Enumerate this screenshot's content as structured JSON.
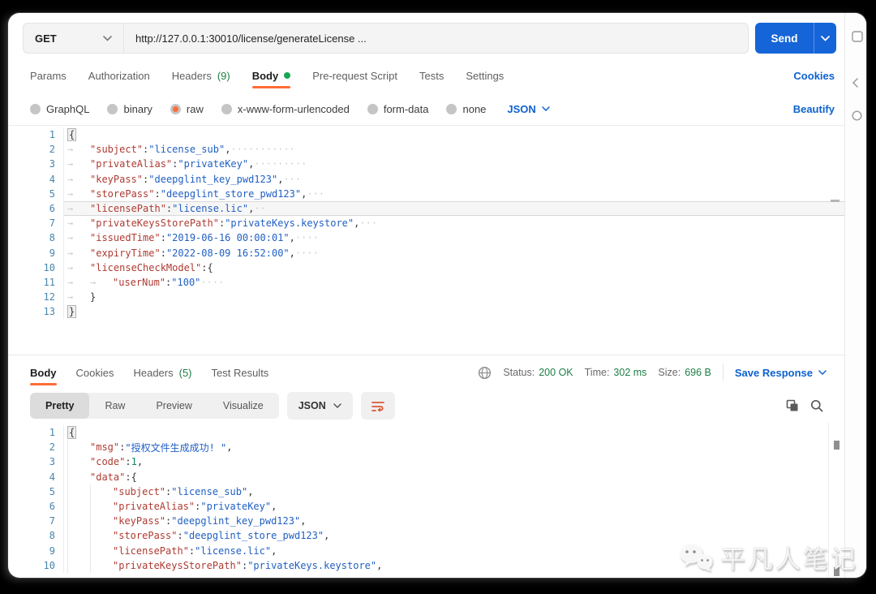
{
  "request_bar": {
    "method": "GET",
    "url": "http://127.0.0.1:30010/license/generateLicense ...",
    "send_label": "Send"
  },
  "request_tabs": {
    "items": [
      {
        "label": "Params"
      },
      {
        "label": "Authorization"
      },
      {
        "label": "Headers",
        "count": "(9)"
      },
      {
        "label": "Body",
        "active": true,
        "dot": true
      },
      {
        "label": "Pre-request Script"
      },
      {
        "label": "Tests"
      },
      {
        "label": "Settings"
      }
    ],
    "cookies_link": "Cookies"
  },
  "body_type_row": {
    "options": [
      {
        "label": "none"
      },
      {
        "label": "form-data"
      },
      {
        "label": "x-www-form-urlencoded"
      },
      {
        "label": "raw",
        "selected": true
      },
      {
        "label": "binary"
      },
      {
        "label": "GraphQL"
      }
    ],
    "language": "JSON",
    "beautify_link": "Beautify"
  },
  "request_editor": {
    "lines": [
      {
        "n": "1",
        "tabs": 0,
        "segs": [
          [
            "brace",
            "{"
          ]
        ]
      },
      {
        "n": "2",
        "tabs": 1,
        "segs": [
          [
            "key",
            "\"subject\""
          ],
          [
            "pun",
            ": "
          ],
          [
            "str",
            "\"license_sub\""
          ],
          [
            "pun",
            ","
          ],
          [
            "ws",
            "···········"
          ]
        ]
      },
      {
        "n": "3",
        "tabs": 1,
        "segs": [
          [
            "key",
            "\"privateAlias\""
          ],
          [
            "pun",
            ": "
          ],
          [
            "str",
            "\"privateKey\""
          ],
          [
            "pun",
            ","
          ],
          [
            "ws",
            "·········"
          ]
        ]
      },
      {
        "n": "4",
        "tabs": 1,
        "segs": [
          [
            "key",
            "\"keyPass\""
          ],
          [
            "pun",
            ": "
          ],
          [
            "str",
            "\"deepglint_key_pwd123\""
          ],
          [
            "pun",
            ","
          ],
          [
            "ws",
            "···"
          ]
        ]
      },
      {
        "n": "5",
        "tabs": 1,
        "segs": [
          [
            "key",
            "\"storePass\""
          ],
          [
            "pun",
            ": "
          ],
          [
            "str",
            "\"deepglint_store_pwd123\""
          ],
          [
            "pun",
            ","
          ],
          [
            "ws",
            "···"
          ]
        ]
      },
      {
        "n": "6",
        "tabs": 1,
        "current": true,
        "segs": [
          [
            "key",
            "\"licensePath\""
          ],
          [
            "pun",
            ": "
          ],
          [
            "str",
            "\"license.lic\""
          ],
          [
            "pun",
            ","
          ],
          [
            "ws",
            "··"
          ]
        ]
      },
      {
        "n": "7",
        "tabs": 1,
        "segs": [
          [
            "key",
            "\"privateKeysStorePath\""
          ],
          [
            "pun",
            ": "
          ],
          [
            "str",
            "\"privateKeys.keystore\""
          ],
          [
            "pun",
            ","
          ],
          [
            "ws",
            "···"
          ]
        ]
      },
      {
        "n": "8",
        "tabs": 1,
        "segs": [
          [
            "key",
            "\"issuedTime\""
          ],
          [
            "pun",
            ": "
          ],
          [
            "str",
            "\"2019-06-16 00:00:01\""
          ],
          [
            "pun",
            ","
          ],
          [
            "ws",
            "····"
          ]
        ]
      },
      {
        "n": "9",
        "tabs": 1,
        "segs": [
          [
            "key",
            "\"expiryTime\""
          ],
          [
            "pun",
            ": "
          ],
          [
            "str",
            "\"2022-08-09 16:52:00\""
          ],
          [
            "pun",
            ","
          ],
          [
            "ws",
            "····"
          ]
        ]
      },
      {
        "n": "10",
        "tabs": 1,
        "segs": [
          [
            "key",
            "\"licenseCheckModel\""
          ],
          [
            "pun",
            ": "
          ],
          [
            "pun",
            "{"
          ]
        ]
      },
      {
        "n": "11",
        "tabs": 2,
        "segs": [
          [
            "key",
            "\"userNum\""
          ],
          [
            "pun",
            ":"
          ],
          [
            "str",
            "\"100\""
          ],
          [
            "ws",
            "····"
          ]
        ]
      },
      {
        "n": "12",
        "tabs": 1,
        "segs": [
          [
            "pun",
            "}"
          ]
        ]
      },
      {
        "n": "13",
        "tabs": 0,
        "segs": [
          [
            "brace",
            "}"
          ]
        ]
      }
    ]
  },
  "response_meta": {
    "tabs": [
      {
        "label": "Body",
        "active": true
      },
      {
        "label": "Cookies"
      },
      {
        "label": "Headers",
        "count": "(5)"
      },
      {
        "label": "Test Results"
      }
    ],
    "status_label": "Status:",
    "status_value": "200 OK",
    "time_label": "Time:",
    "time_value": "302 ms",
    "size_label": "Size:",
    "size_value": "696 B",
    "save_response_label": "Save Response"
  },
  "response_toolbar": {
    "views": [
      {
        "label": "Pretty",
        "active": true
      },
      {
        "label": "Raw"
      },
      {
        "label": "Preview"
      },
      {
        "label": "Visualize"
      }
    ],
    "language": "JSON"
  },
  "response_editor": {
    "lines": [
      {
        "n": "1",
        "guides": 0,
        "segs": [
          [
            "brace",
            "{"
          ]
        ]
      },
      {
        "n": "2",
        "guides": 1,
        "segs": [
          [
            "key",
            "\"msg\""
          ],
          [
            "pun",
            ": "
          ],
          [
            "str",
            "\"授权文件生成成功! \""
          ],
          [
            "pun",
            ","
          ]
        ]
      },
      {
        "n": "3",
        "guides": 1,
        "segs": [
          [
            "key",
            "\"code\""
          ],
          [
            "pun",
            ": "
          ],
          [
            "num",
            "1"
          ],
          [
            "pun",
            ","
          ]
        ]
      },
      {
        "n": "4",
        "guides": 1,
        "segs": [
          [
            "key",
            "\"data\""
          ],
          [
            "pun",
            ": "
          ],
          [
            "pun",
            "{"
          ]
        ]
      },
      {
        "n": "5",
        "guides": 2,
        "segs": [
          [
            "key",
            "\"subject\""
          ],
          [
            "pun",
            ": "
          ],
          [
            "str",
            "\"license_sub\""
          ],
          [
            "pun",
            ","
          ]
        ]
      },
      {
        "n": "6",
        "guides": 2,
        "segs": [
          [
            "key",
            "\"privateAlias\""
          ],
          [
            "pun",
            ": "
          ],
          [
            "str",
            "\"privateKey\""
          ],
          [
            "pun",
            ","
          ]
        ]
      },
      {
        "n": "7",
        "guides": 2,
        "segs": [
          [
            "key",
            "\"keyPass\""
          ],
          [
            "pun",
            ": "
          ],
          [
            "str",
            "\"deepglint_key_pwd123\""
          ],
          [
            "pun",
            ","
          ]
        ]
      },
      {
        "n": "8",
        "guides": 2,
        "segs": [
          [
            "key",
            "\"storePass\""
          ],
          [
            "pun",
            ": "
          ],
          [
            "str",
            "\"deepglint_store_pwd123\""
          ],
          [
            "pun",
            ","
          ]
        ]
      },
      {
        "n": "9",
        "guides": 2,
        "segs": [
          [
            "key",
            "\"licensePath\""
          ],
          [
            "pun",
            ": "
          ],
          [
            "str",
            "\"license.lic\""
          ],
          [
            "pun",
            ","
          ]
        ]
      },
      {
        "n": "10",
        "guides": 2,
        "segs": [
          [
            "key",
            "\"privateKeysStorePath\""
          ],
          [
            "pun",
            ": "
          ],
          [
            "str",
            "\"privateKeys.keystore\""
          ],
          [
            "pun",
            ","
          ]
        ]
      }
    ]
  },
  "watermark": {
    "text": "平凡人笔记"
  },
  "icons": {
    "toolbar": [
      "wrap-text-icon",
      "copy-icon",
      "search-icon"
    ],
    "meta": [
      "globe-icon"
    ],
    "rail": [
      "panel-icon",
      "chevron-left-icon",
      "circle-icon"
    ],
    "watermark": [
      "wechat-icon"
    ]
  },
  "colors": {
    "accent_orange": "#ff6c37",
    "primary_blue": "#1665d8",
    "link_blue": "#0d62d0",
    "success_green": "#1e7e45",
    "code_key": "#ae3b32",
    "code_string": "#2160c4",
    "code_number": "#0e8a57"
  }
}
